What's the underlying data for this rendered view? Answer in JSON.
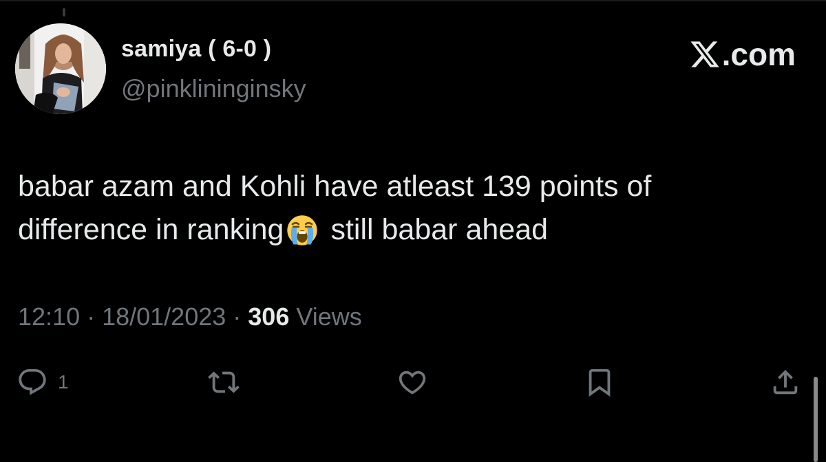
{
  "author": {
    "display_name": "samiya ( 6-0 )",
    "handle": "@pinklininginsky"
  },
  "brand": {
    "label": ".com",
    "icon": "x-logo-icon"
  },
  "tweet": {
    "line1": "babar azam and Kohli have atleast 139 points of",
    "line2_before_emoji": "difference in ranking",
    "emoji": "loudly-crying-face-emoji",
    "line2_after_emoji": "still babar ahead"
  },
  "meta": {
    "time": "12:10",
    "separator": " · ",
    "date": "18/01/2023",
    "views_count": "306",
    "views_label": " Views"
  },
  "actions": {
    "reply": {
      "icon": "reply-icon",
      "count": "1"
    },
    "retweet": {
      "icon": "retweet-icon"
    },
    "like": {
      "icon": "heart-icon"
    },
    "bookmark": {
      "icon": "bookmark-icon"
    },
    "share": {
      "icon": "share-icon"
    }
  },
  "colors": {
    "background": "#000000",
    "primary_text": "#e7e9ea",
    "secondary_text": "#71767b",
    "emoji_yellow": "#ffcc4d",
    "emoji_tears": "#5dadec"
  }
}
